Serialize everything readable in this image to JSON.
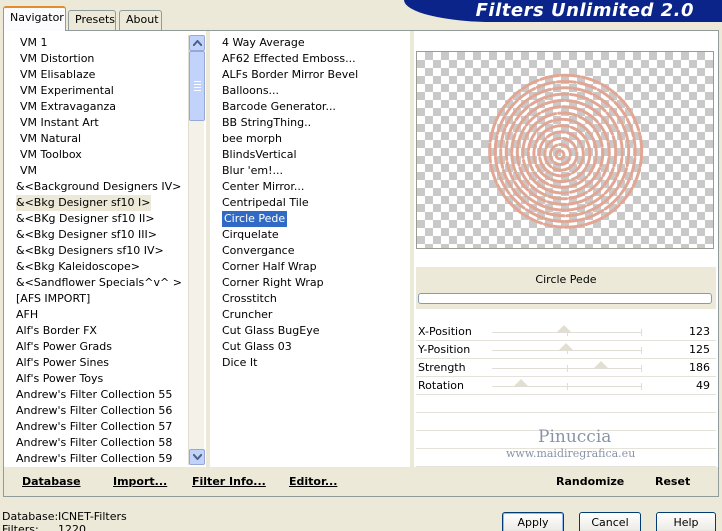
{
  "header": {
    "title": "Filters Unlimited 2.0"
  },
  "tabs": [
    {
      "label": "Navigator",
      "active": true
    },
    {
      "label": "Presets",
      "active": false
    },
    {
      "label": "About",
      "active": false
    }
  ],
  "categories": [
    "VM 1",
    "VM Distortion",
    "VM Elisablaze",
    "VM Experimental",
    "VM Extravaganza",
    "VM Instant Art",
    "VM Natural",
    "VM Toolbox",
    "VM",
    "&<Background Designers IV>",
    "&<Bkg Designer sf10 I>",
    "&<BKg Designer sf10 II>",
    "&<Bkg Designer sf10 III>",
    "&<Bkg Designers sf10 IV>",
    "&<Bkg Kaleidoscope>",
    "&<Sandflower Specials^v^ >",
    "[AFS IMPORT]",
    "AFH",
    "Alf's Border FX",
    "Alf's Power Grads",
    "Alf's Power Sines",
    "Alf's Power Toys",
    "Andrew's Filter Collection 55",
    "Andrew's Filter Collection 56",
    "Andrew's Filter Collection 57",
    "Andrew's Filter Collection 58",
    "Andrew's Filter Collection 59"
  ],
  "filters": [
    "4 Way Average",
    "AF62 Effected Emboss...",
    "ALFs Border Mirror Bevel",
    "Balloons...",
    "Barcode Generator...",
    "BB StringThing..",
    "bee morph",
    "BlindsVertical",
    "Blur 'em!...",
    "Center Mirror...",
    "Centripedal Tile",
    "Circle Pede",
    "Cirquelate",
    "Convergance",
    "Corner Half Wrap",
    "Corner Right Wrap",
    "Crosstitch",
    "Cruncher",
    "Cut Glass  BugEye",
    "Cut Glass 03",
    "Dice It"
  ],
  "selected_filter": "Circle Pede",
  "params": [
    {
      "label": "X-Position",
      "value": "123",
      "level": 123
    },
    {
      "label": "Y-Position",
      "value": "125",
      "level": 125
    },
    {
      "label": "Strength",
      "value": "186",
      "level": 186
    },
    {
      "label": "Rotation",
      "value": "49",
      "level": 49
    }
  ],
  "watermark": {
    "line1": "Pinuccia",
    "line2": "www.maidiregrafica.eu"
  },
  "actions": {
    "database": "Database",
    "import": "Import...",
    "filter_info": "Filter Info...",
    "editor": "Editor...",
    "randomize": "Randomize",
    "reset": "Reset"
  },
  "status": {
    "database_label": "Database:",
    "database_value": "ICNET-Filters",
    "filters_label": "Filters:",
    "filters_value": "1220"
  },
  "buttons": {
    "apply": "Apply",
    "cancel": "Cancel",
    "help": "Help"
  },
  "colors": {
    "selection": "#316AC5",
    "banner": "#0A2489",
    "ring": "#E2A794"
  }
}
